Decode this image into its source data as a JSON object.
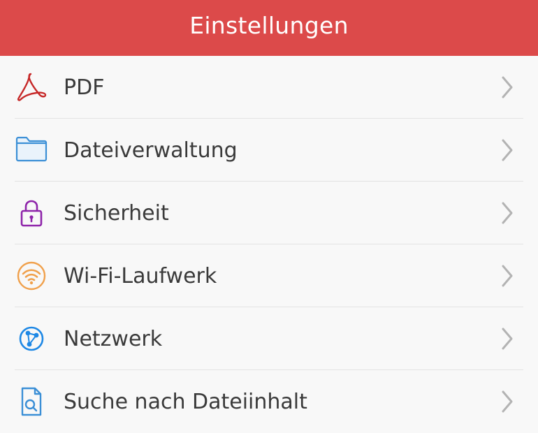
{
  "header": {
    "title": "Einstellungen"
  },
  "settings": {
    "items": [
      {
        "label": "PDF",
        "icon": "pdf-icon",
        "color": "#c62828"
      },
      {
        "label": "Dateiverwaltung",
        "icon": "folder-icon",
        "color": "#3b8fd6"
      },
      {
        "label": "Sicherheit",
        "icon": "lock-icon",
        "color": "#8e24aa"
      },
      {
        "label": "Wi-Fi-Laufwerk",
        "icon": "wifi-icon",
        "color": "#f0a04b"
      },
      {
        "label": "Netzwerk",
        "icon": "network-icon",
        "color": "#1e88e5"
      },
      {
        "label": "Suche nach Dateiinhalt",
        "icon": "search-file-icon",
        "color": "#3b8fd6"
      }
    ]
  },
  "colors": {
    "header_bg": "#dc4a4a",
    "chevron": "#b3b3b3",
    "separator": "#e3e3e3"
  }
}
